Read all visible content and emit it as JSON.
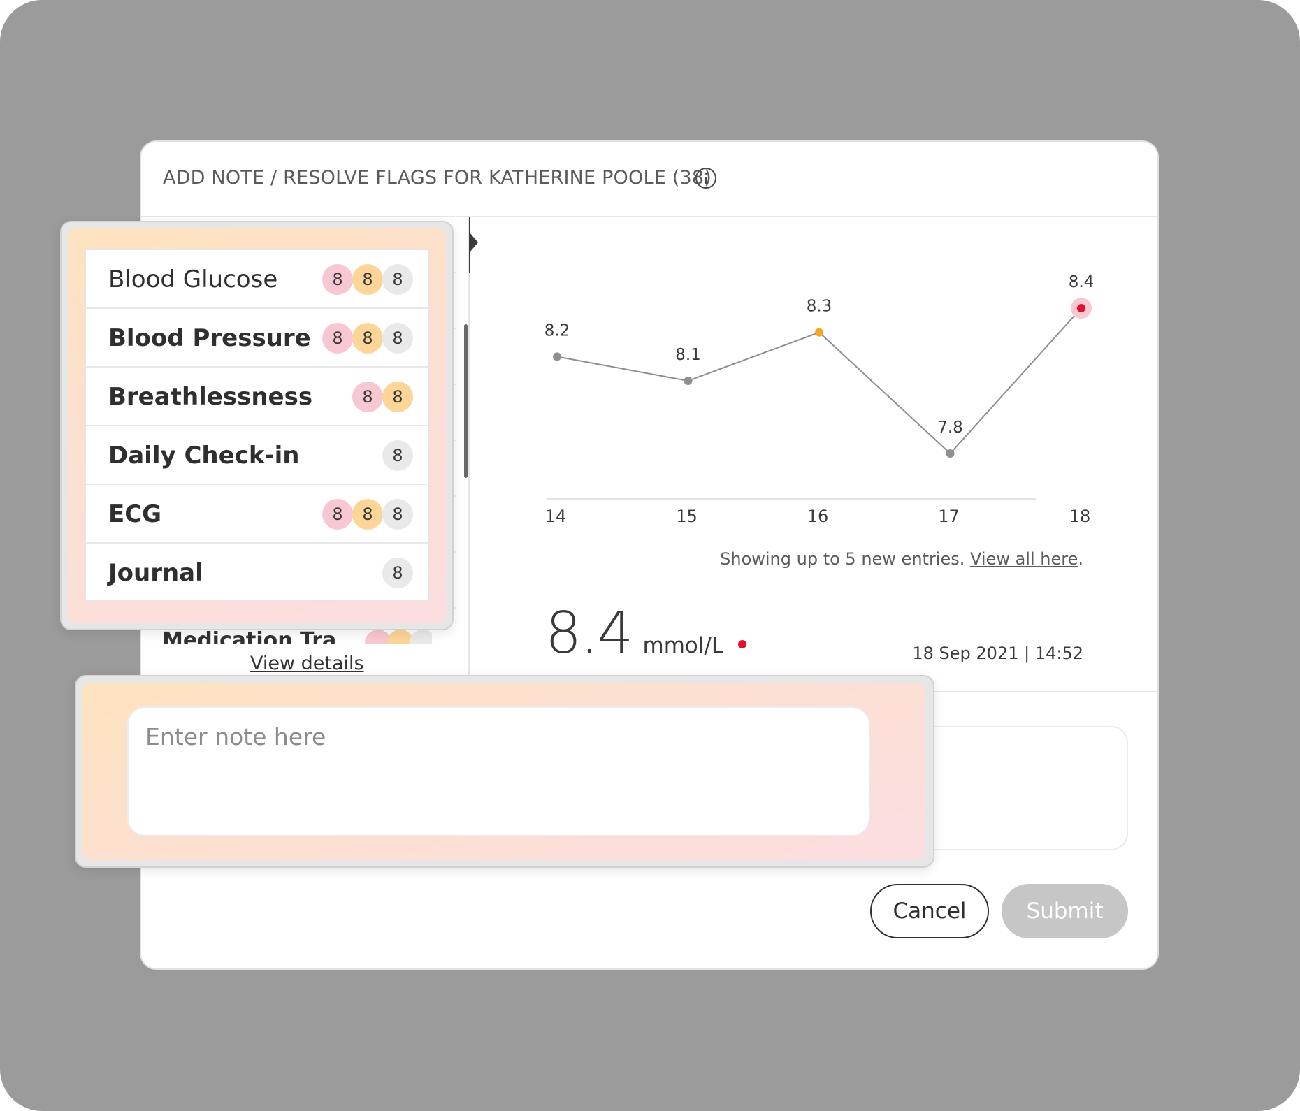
{
  "modal": {
    "title": "ADD NOTE / RESOLVE FLAGS FOR KATHERINE POOLE (38)",
    "info_icon": "info-circle-icon"
  },
  "metrics": {
    "items": [
      {
        "label": "Blood Glucose",
        "bold": false,
        "pills": [
          {
            "value": "8",
            "color": "pink"
          },
          {
            "value": "8",
            "color": "orange"
          },
          {
            "value": "8",
            "color": "gray"
          }
        ]
      },
      {
        "label": "Blood Pressure",
        "bold": true,
        "pills": [
          {
            "value": "8",
            "color": "pink"
          },
          {
            "value": "8",
            "color": "orange"
          },
          {
            "value": "8",
            "color": "gray"
          }
        ]
      },
      {
        "label": "Breathlessness",
        "bold": true,
        "pills": [
          {
            "value": "8",
            "color": "pink"
          },
          {
            "value": "8",
            "color": "orange"
          }
        ]
      },
      {
        "label": "Daily Check-in",
        "bold": true,
        "pills": [
          {
            "value": "8",
            "color": "gray"
          }
        ]
      },
      {
        "label": "ECG",
        "bold": true,
        "pills": [
          {
            "value": "8",
            "color": "pink"
          },
          {
            "value": "8",
            "color": "orange"
          },
          {
            "value": "8",
            "color": "gray"
          }
        ]
      },
      {
        "label": "Journal",
        "bold": true,
        "pills": [
          {
            "value": "8",
            "color": "gray"
          }
        ]
      }
    ],
    "partial_item_label": "Medication Tra",
    "view_details": "View details"
  },
  "chart_data": {
    "type": "line",
    "x": [
      14,
      15,
      16,
      17,
      18
    ],
    "values": [
      8.2,
      8.1,
      8.3,
      7.8,
      8.4
    ],
    "point_status": [
      "normal",
      "normal",
      "warning",
      "normal",
      "alert"
    ],
    "status_colors": {
      "normal": "#8e8e93",
      "warning": "#f5a623",
      "alert": "#e0102e",
      "alert_halo": "#f9c9d2"
    },
    "line_color": "#8e8e8e",
    "ylim": [
      7.8,
      8.4
    ],
    "legend": "none",
    "grid": false
  },
  "caption": {
    "text": "Showing up to 5 new entries. ",
    "link": "View all here",
    "end": "."
  },
  "reading": {
    "value": "8.4",
    "unit": "mmol/L",
    "datetime": "18 Sep 2021 | 14:52",
    "status_color": "#e0102e"
  },
  "note": {
    "placeholder": "Enter note here"
  },
  "actions": {
    "cancel": "Cancel",
    "submit": "Submit"
  }
}
